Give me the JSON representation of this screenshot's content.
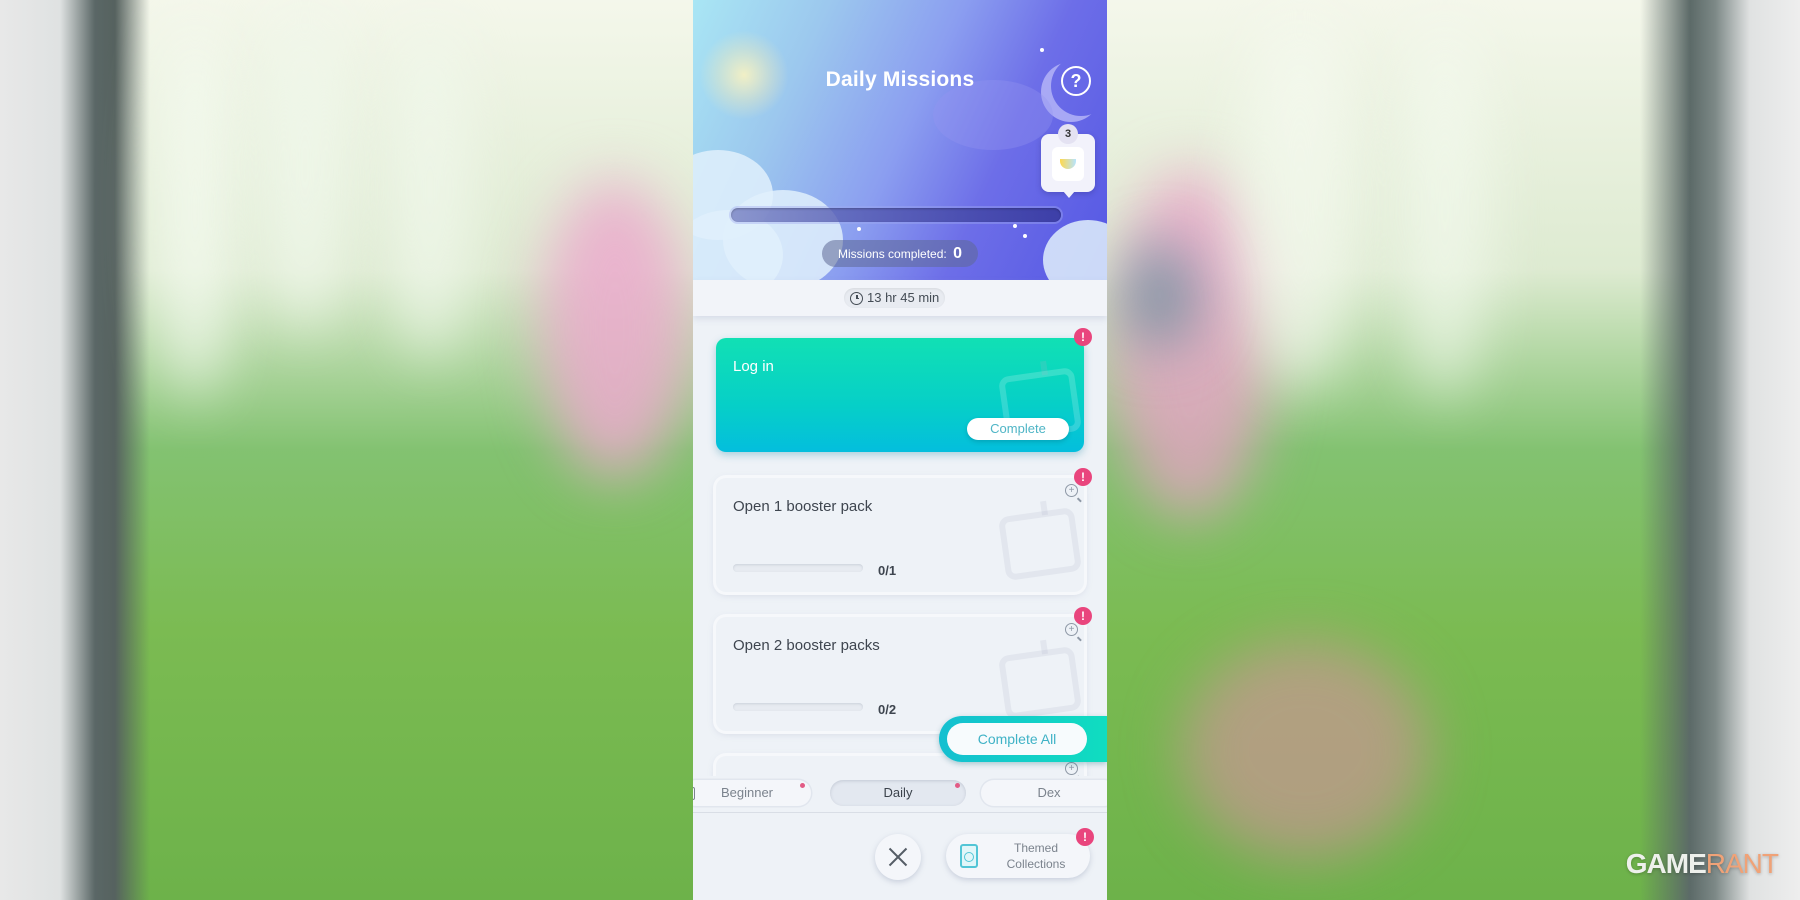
{
  "header": {
    "title": "Daily Missions",
    "help_label": "?",
    "reward": {
      "count": "3",
      "icon": "trophy-icon"
    },
    "progress_fraction": 0,
    "missions_completed_label": "Missions completed:",
    "missions_completed_value": "0"
  },
  "timer": {
    "icon": "clock-icon",
    "text": "13 hr 45 min"
  },
  "missions": [
    {
      "label": "Log in",
      "status": "complete",
      "button_label": "Complete",
      "alert": "!"
    },
    {
      "label": "Open 1 booster pack",
      "status": "in-progress",
      "progress": "0/1",
      "progress_fraction": 0,
      "alert": "!"
    },
    {
      "label": "Open 2 booster packs",
      "status": "in-progress",
      "progress": "0/2",
      "progress_fraction": 0,
      "alert": "!"
    }
  ],
  "complete_all_label": "Complete All",
  "tabs": [
    {
      "label": "Beginner",
      "active": false,
      "notification": true
    },
    {
      "label": "Daily",
      "active": true,
      "notification": true
    },
    {
      "label": "Dex",
      "active": false,
      "notification": false
    }
  ],
  "footer": {
    "close_icon": "close-icon",
    "themed_line1": "Themed",
    "themed_line2": "Collections",
    "themed_alert": "!"
  },
  "colors": {
    "accent_teal": "#10ddc0",
    "alert_pink": "#e9457d",
    "header_purple": "#5558e4"
  },
  "watermark": {
    "part1": "GAME",
    "part2": "RANT"
  }
}
